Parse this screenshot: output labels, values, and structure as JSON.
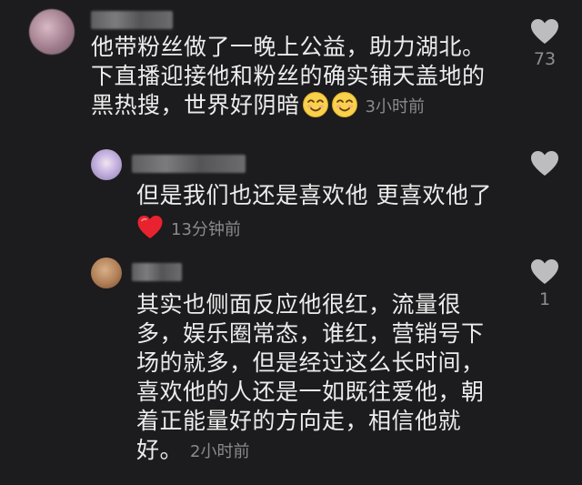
{
  "comments": [
    {
      "text_line_1": "他带粉丝做了一晚上公益，助力湖北。",
      "text_line_2": "下直播迎接他和粉丝的确实铺天盖地的",
      "text_line_3": "黑热搜，世界好阴暗",
      "time": "3小时前",
      "likes": "73",
      "emoji": "smiling-face-emoji"
    },
    {
      "text_line_1": "但是我们也还是喜欢他 更喜欢他了",
      "time": "13分钟前",
      "emoji": "red-heart-emoji"
    },
    {
      "text_line_1": "其实也侧面反应他很红，流量很",
      "text_line_2": "多，娱乐圈常态，谁红，营销号下",
      "text_line_3": "场的就多，但是经过这么长时间，",
      "text_line_4": "喜欢他的人还是一如既往爱他，朝",
      "text_line_5": "着正能量好的方向走，相信他就",
      "text_line_6": "好。",
      "time": "2小时前",
      "likes": "1"
    }
  ],
  "colors": {
    "background": "#1c1b1d",
    "text": "#ececec",
    "muted": "#8a8a8d",
    "heart_outline": "#bdbdc0",
    "emoji_heart": "#e8232f"
  }
}
